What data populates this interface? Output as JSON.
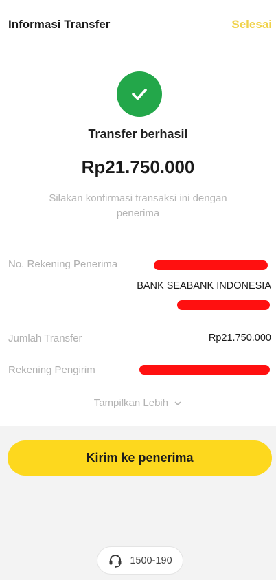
{
  "header": {
    "title": "Informasi Transfer",
    "done_label": "Selesai"
  },
  "status": {
    "icon": "check-icon",
    "title": "Transfer berhasil",
    "amount": "Rp21.750.000",
    "note": "Silakan konfirmasi transaksi ini dengan penerima"
  },
  "details": {
    "recipient_account_label": "No. Rekening Penerima",
    "recipient_bank": "BANK SEABANK INDONESIA",
    "transfer_amount_label": "Jumlah Transfer",
    "transfer_amount_value": "Rp21.750.000",
    "sender_account_label": "Rekening Pengirim",
    "show_more_label": "Tampilkan Lebih"
  },
  "actions": {
    "send_label": "Kirim ke penerima"
  },
  "hotline": {
    "icon": "headset-icon",
    "number": "1500-190"
  },
  "colors": {
    "accent_yellow": "#fdd81e",
    "done_text": "#f0d24b",
    "success_green": "#23a74a",
    "redaction": "#ff1010"
  }
}
